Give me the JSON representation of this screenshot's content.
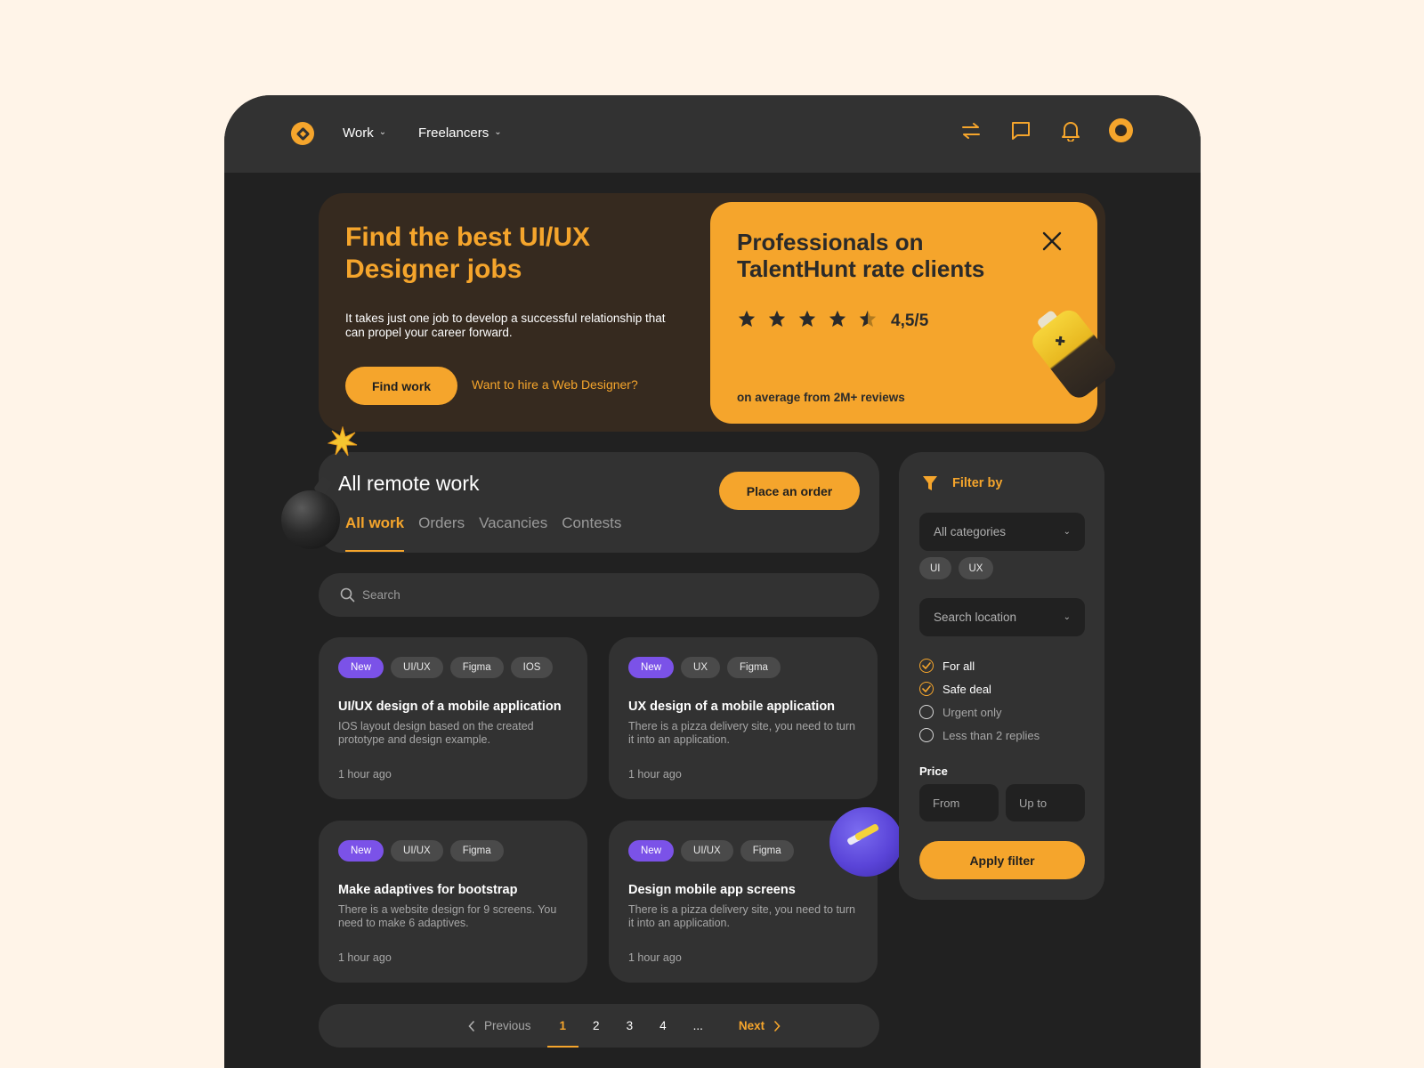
{
  "colors": {
    "accent": "#F5A52C",
    "new_tag": "#7B52E8",
    "background": "#FFF4E8",
    "surface": "#323232",
    "canvas": "#212121"
  },
  "nav": {
    "items": [
      {
        "label": "Work"
      },
      {
        "label": "Freelancers"
      }
    ],
    "icons": [
      "swap-icon",
      "chat-icon",
      "bell-icon",
      "avatar"
    ]
  },
  "hero": {
    "title": "Find the best UI/UX Designer jobs",
    "description": "It takes just one job to develop a successful relationship that can propel your career forward.",
    "find_button": "Find work",
    "hire_link": "Want to hire a Web Designer?"
  },
  "promo": {
    "title": "Professionals on TalentHunt rate clients",
    "rating_value": 4.5,
    "rating_text": "4,5/5",
    "subtitle": "on average from 2M+ reviews"
  },
  "work": {
    "title": "All remote work",
    "order_button": "Place an order",
    "tabs": [
      {
        "label": "All work",
        "active": true
      },
      {
        "label": "Orders"
      },
      {
        "label": "Vacancies"
      },
      {
        "label": "Contests"
      }
    ],
    "search_placeholder": "Search"
  },
  "jobs": [
    {
      "tags": [
        "New",
        "UI/UX",
        "Figma",
        "IOS"
      ],
      "title": "UI/UX design of a mobile application",
      "description": "IOS layout design based on the created prototype and design example.",
      "time": "1 hour ago"
    },
    {
      "tags": [
        "New",
        "UX",
        "Figma"
      ],
      "title": "UX design of a mobile application",
      "description": "There is a pizza delivery site, you need to turn it into an application.",
      "time": "1 hour ago"
    },
    {
      "tags": [
        "New",
        "UI/UX",
        "Figma"
      ],
      "title": "Make adaptives for bootstrap",
      "description": "There is a website design for 9 screens. You need to make 6 adaptives.",
      "time": "1 hour ago"
    },
    {
      "tags": [
        "New",
        "UI/UX",
        "Figma"
      ],
      "title": "Design mobile app screens",
      "description": "There is a pizza delivery site, you need to turn it into an application.",
      "time": "1 hour ago"
    }
  ],
  "pagination": {
    "previous": "Previous",
    "next": "Next",
    "pages": [
      "1",
      "2",
      "3",
      "4",
      "..."
    ],
    "current": "1"
  },
  "filter": {
    "title": "Filter by",
    "category_placeholder": "All categories",
    "chips": [
      "UI",
      "UX"
    ],
    "location_placeholder": "Search location",
    "options": [
      {
        "label": "For all",
        "checked": true
      },
      {
        "label": "Safe deal",
        "checked": true
      },
      {
        "label": "Urgent only",
        "checked": false
      },
      {
        "label": "Less than 2 replies",
        "checked": false
      }
    ],
    "price_label": "Price",
    "price_from_placeholder": "From",
    "price_to_placeholder": "Up to",
    "apply_button": "Apply filter"
  }
}
